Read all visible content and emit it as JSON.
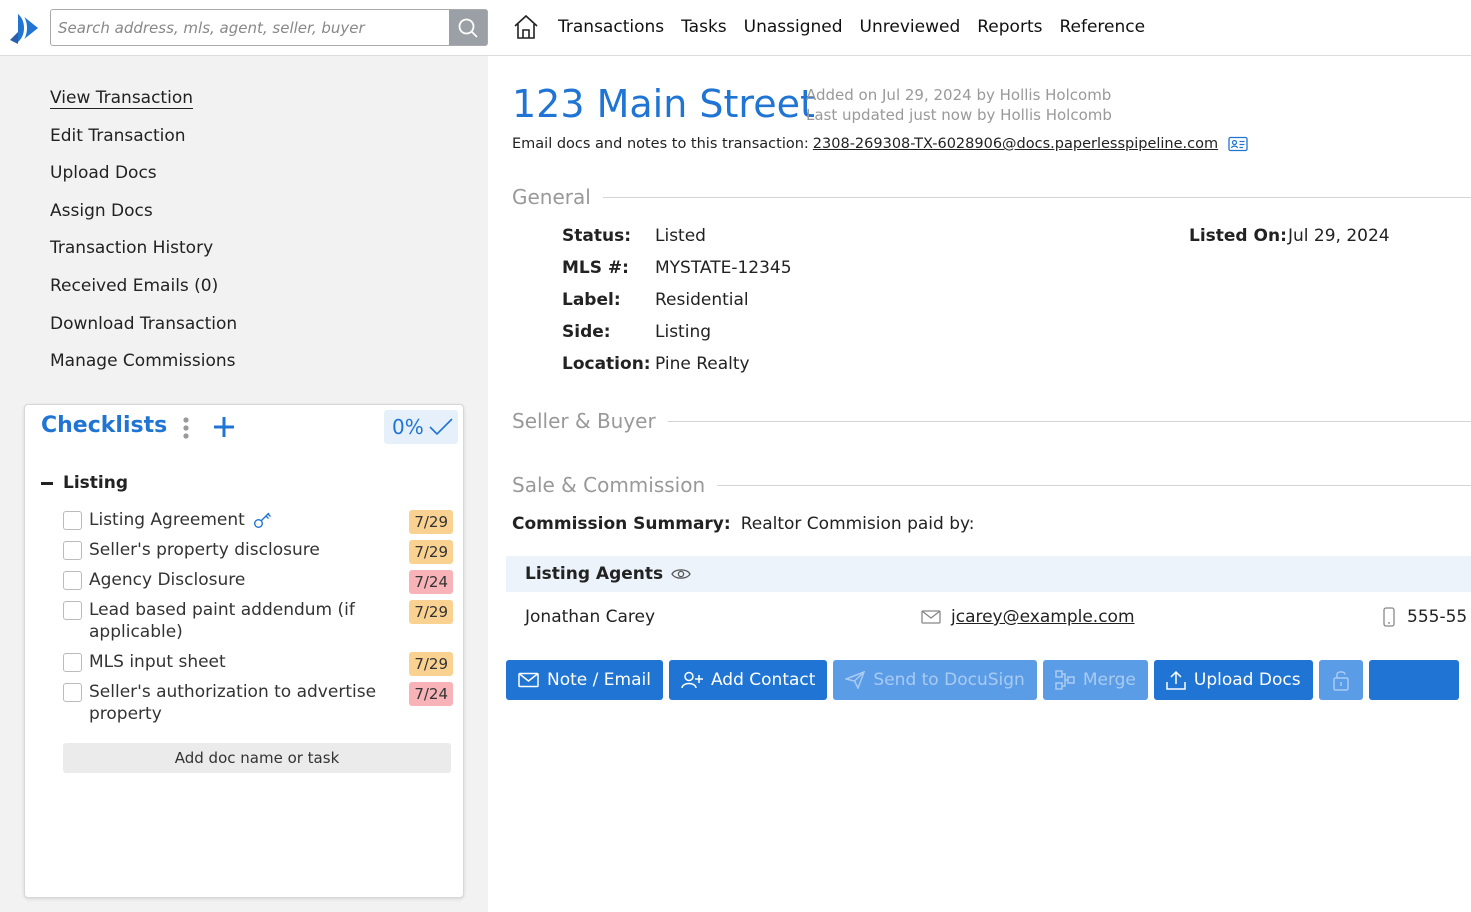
{
  "search": {
    "placeholder": "Search address, mls, agent, seller, buyer"
  },
  "nav": {
    "items": [
      "Transactions",
      "Tasks",
      "Unassigned",
      "Unreviewed",
      "Reports",
      "Reference"
    ]
  },
  "sidebar_menu": {
    "items": [
      "View Transaction",
      "Edit Transaction",
      "Upload Docs",
      "Assign Docs",
      "Transaction History",
      "Received Emails (0)",
      "Download Transaction",
      "Manage Commissions"
    ]
  },
  "checklists": {
    "title": "Checklists",
    "percent": "0%",
    "group": "Listing",
    "items": [
      {
        "label": "Listing Agreement",
        "date": "7/29",
        "status": "orange"
      },
      {
        "label": "Seller's property disclosure",
        "date": "7/29",
        "status": "orange"
      },
      {
        "label": "Agency Disclosure",
        "date": "7/24",
        "status": "red"
      },
      {
        "label": "Lead based paint addendum (if applicable)",
        "date": "7/29",
        "status": "orange"
      },
      {
        "label": "MLS input sheet",
        "date": "7/29",
        "status": "orange"
      },
      {
        "label": "Seller's authorization to advertise property",
        "date": "7/24",
        "status": "red"
      }
    ],
    "add_placeholder": "Add doc name or task"
  },
  "transaction": {
    "address": "123 Main Street",
    "added": "Added on Jul 29, 2024 by Hollis Holcomb",
    "updated": "Last updated just now by Hollis Holcomb",
    "email_label": "Email docs and notes to this transaction:",
    "email_address": "2308-269308-TX-6028906@docs.paperlesspipeline.com"
  },
  "sections": {
    "general": "General",
    "seller_buyer": "Seller & Buyer",
    "sale_commission": "Sale & Commission"
  },
  "general": {
    "status_label": "Status:",
    "status": "Listed",
    "mls_label": "MLS #:",
    "mls": "MYSTATE-12345",
    "label_label": "Label:",
    "label": "Residential",
    "side_label": "Side:",
    "side": "Listing",
    "location_label": "Location:",
    "location": "Pine Realty",
    "listed_on_label": "Listed On:",
    "listed_on": "Jul 29, 2024"
  },
  "commission": {
    "label": "Commission Summary:",
    "value": "Realtor Commision paid by:"
  },
  "listing_agents": {
    "title": "Listing Agents",
    "agents": [
      {
        "name": "Jonathan Carey",
        "email": "jcarey@example.com",
        "phone": "555-55"
      }
    ]
  },
  "actions": {
    "note_email": "Note / Email",
    "add_contact": "Add Contact",
    "docusign": "Send to DocuSign",
    "merge": "Merge",
    "upload_docs": "Upload Docs"
  },
  "colors": {
    "accent": "#1f74d4",
    "accent_disabled": "#5b9ce6",
    "date_orange": "#f9d291",
    "date_red": "#f7b3b8"
  }
}
